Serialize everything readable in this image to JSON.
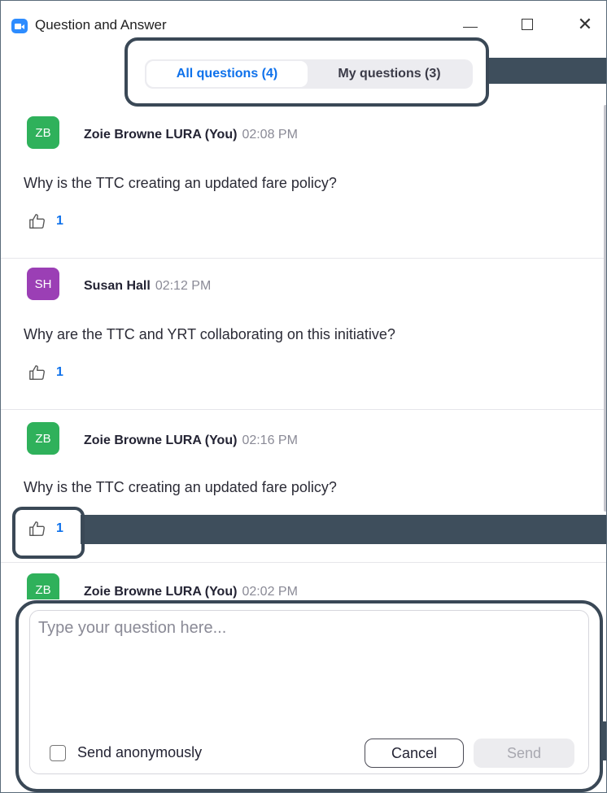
{
  "window": {
    "title": "Question and Answer",
    "minimize_icon": "minimize-icon",
    "maximize_icon": "maximize-icon",
    "close_glyph": "✕"
  },
  "tabs": [
    {
      "label": "All questions (4)",
      "active": true
    },
    {
      "label": "My questions (3)",
      "active": false
    }
  ],
  "questions": [
    {
      "initials": "ZB",
      "avatar_color": "#2fb15b",
      "name": "Zoie Browne LURA (You)",
      "time": "02:08 PM",
      "text": "Why is the TTC creating an updated fare policy?",
      "likes": "1"
    },
    {
      "initials": "SH",
      "avatar_color": "#9b3fb5",
      "name": "Susan Hall",
      "time": "02:12 PM",
      "text": "Why are the TTC and YRT collaborating on this initiative?",
      "likes": "1"
    },
    {
      "initials": "ZB",
      "avatar_color": "#2fb15b",
      "name": "Zoie Browne LURA (You)",
      "time": "02:16 PM",
      "text": "Why is the TTC creating an updated fare policy?",
      "likes": "1"
    },
    {
      "initials": "ZB",
      "avatar_color": "#2fb15b",
      "name": "Zoie Browne LURA (You)",
      "time": "02:02 PM",
      "text": "",
      "likes": ""
    }
  ],
  "compose": {
    "placeholder": "Type your question here...",
    "anonymous_label": "Send anonymously",
    "cancel_label": "Cancel",
    "send_label": "Send"
  },
  "colors": {
    "accent": "#0e71eb",
    "callout": "#3a4856"
  }
}
